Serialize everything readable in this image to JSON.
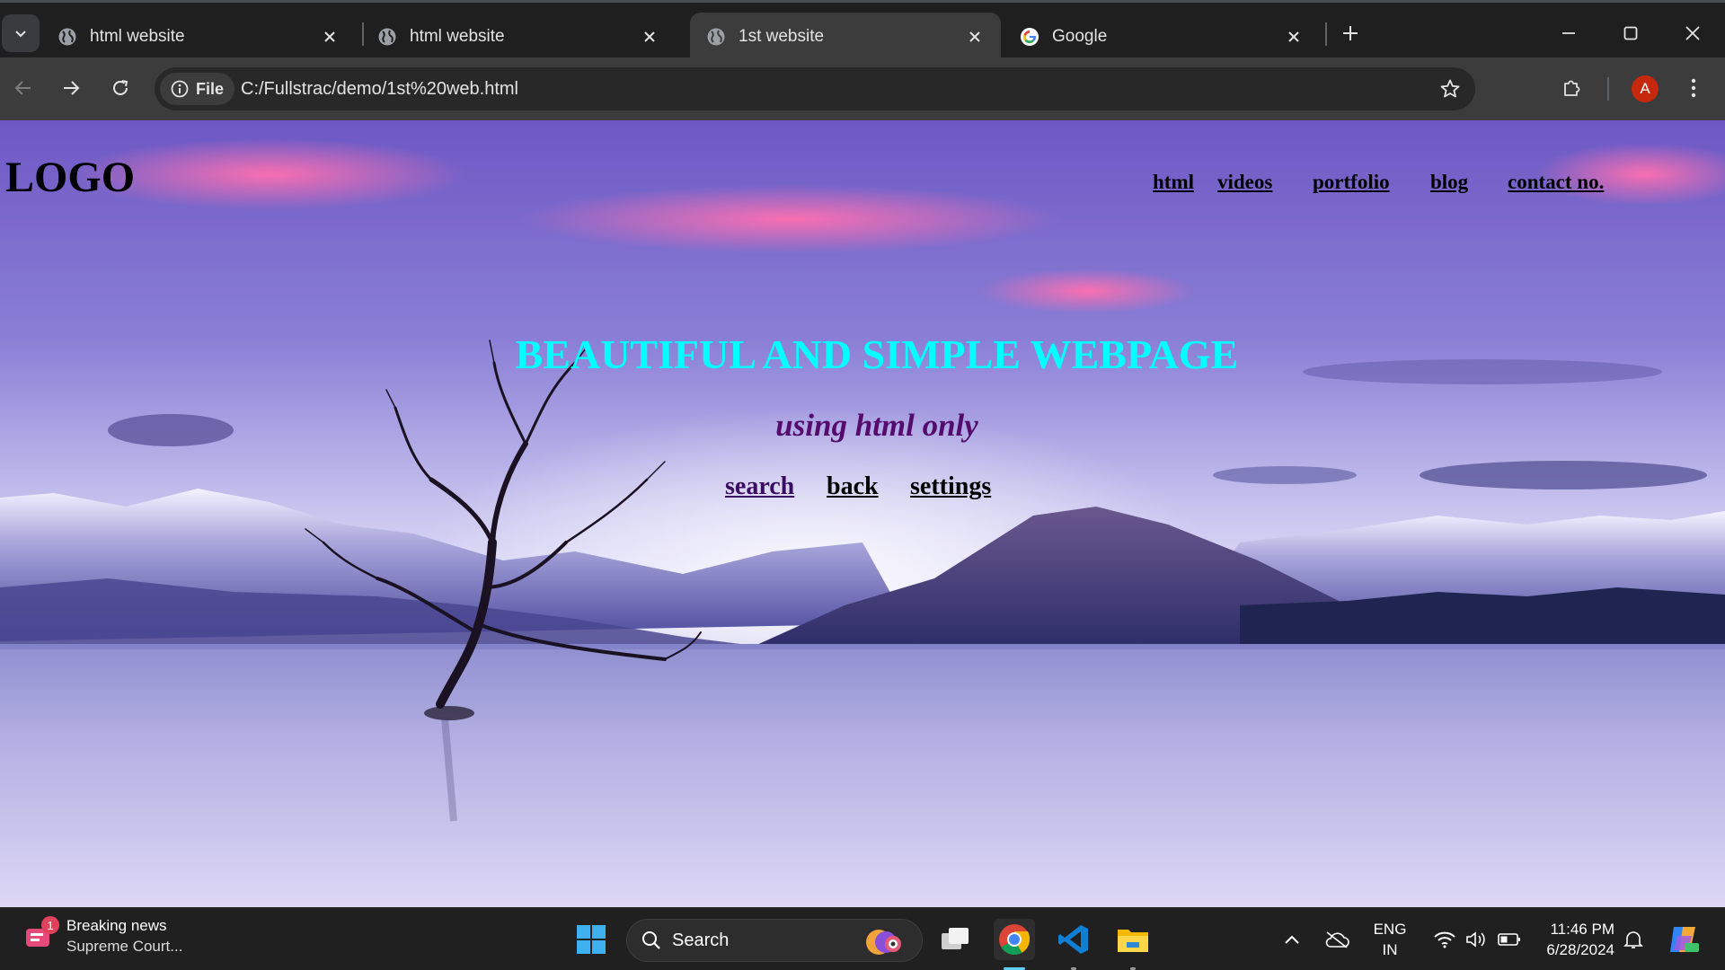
{
  "browser": {
    "tabs": [
      {
        "title": "html website",
        "favicon": "globe-icon",
        "active": false
      },
      {
        "title": "html website",
        "favicon": "globe-icon",
        "active": false
      },
      {
        "title": "1st website",
        "favicon": "globe-icon",
        "active": true
      },
      {
        "title": "Google",
        "favicon": "google-icon",
        "active": false
      }
    ],
    "site_info_label": "File",
    "url": "C:/Fullstrac/demo/1st%20web.html",
    "profile_initial": "A"
  },
  "page": {
    "logo": "LOGO",
    "nav": [
      "html",
      "videos",
      "portfolio",
      "blog",
      "contact no."
    ],
    "title": "BEAUTIFUL AND SIMPLE WEBPAGE",
    "subtitle": "using html only",
    "links": [
      "search",
      "back",
      "settings"
    ],
    "colors": {
      "title": "#00ffff",
      "subtitle": "#550a6e"
    }
  },
  "taskbar": {
    "news_title": "Breaking news",
    "news_subtitle": "Supreme Court...",
    "news_badge": "1",
    "search_placeholder": "Search",
    "lang_top": "ENG",
    "lang_bottom": "IN",
    "time": "11:46 PM",
    "date": "6/28/2024"
  }
}
